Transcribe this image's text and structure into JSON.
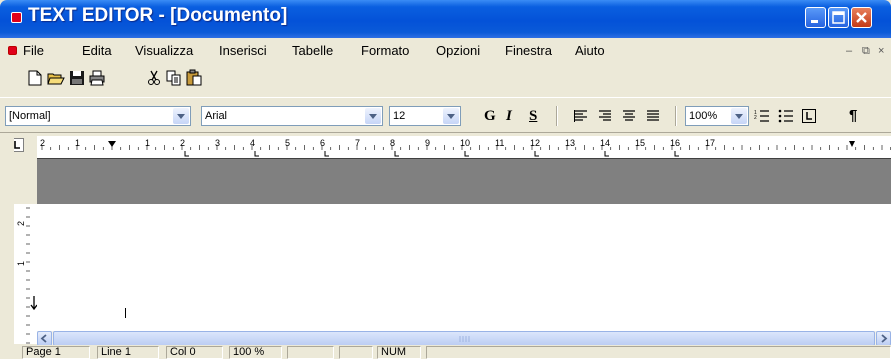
{
  "window": {
    "title": "TEXT EDITOR - [Documento]",
    "controls": [
      "minimize",
      "maximize",
      "close"
    ]
  },
  "menubar": {
    "items": [
      "File",
      "Edita",
      "Visualizza",
      "Inserisci",
      "Tabelle",
      "Formato",
      "Opzioni",
      "Finestra",
      "Aiuto"
    ]
  },
  "toolbar": {
    "icons": [
      "new-document-icon",
      "open-folder-icon",
      "save-icon",
      "print-icon",
      "cut-icon",
      "copy-icon",
      "paste-icon"
    ]
  },
  "format_bar": {
    "style": "[Normal]",
    "font": "Arial",
    "size": "12",
    "bold_label": "G",
    "italic_label": "I",
    "underline_label": "S",
    "zoom": "100%",
    "pilcrow": "¶"
  },
  "ruler": {
    "numbers": [
      "2",
      "1",
      "1",
      "2",
      "3",
      "4",
      "5",
      "6",
      "7",
      "8",
      "9",
      "10",
      "11",
      "12",
      "13",
      "14",
      "15",
      "16",
      "17"
    ]
  },
  "vertical_ruler": {
    "numbers": [
      "2",
      "1"
    ]
  },
  "status": {
    "page": "Page  1",
    "line": "Line  1",
    "col": "Col  0",
    "zoom": "100 %",
    "num": "NUM"
  },
  "colors": {
    "titlebar": "#0452d8",
    "close_button": "#c43a16",
    "chrome": "#ece9d8"
  }
}
